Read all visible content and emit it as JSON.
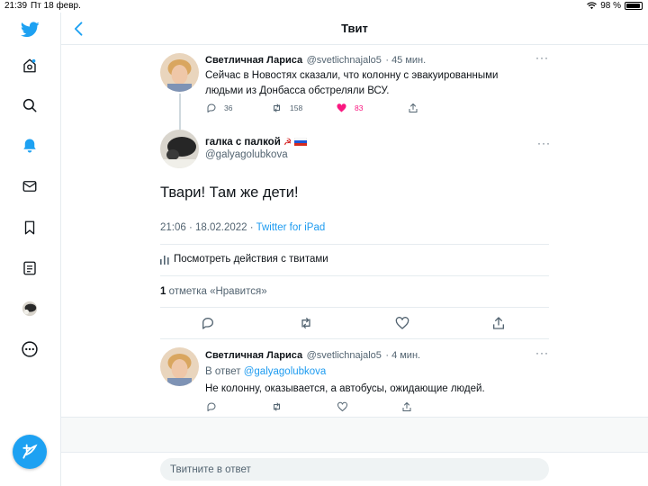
{
  "status_bar": {
    "time": "21:39",
    "date": "Пт 18 февр.",
    "battery": "98 %"
  },
  "header": {
    "title": "Твит"
  },
  "parent_tweet": {
    "name": "Светличная Лариса",
    "handle": "@svetlichnajalo5",
    "time": "· 45 мин.",
    "text": "Сейчас в Новостях сказали, что колонну с эвакуированными людьми из Донбасса обстреляли ВСУ.",
    "replies": "36",
    "retweets": "158",
    "likes": "83",
    "liked_color": "#f91880"
  },
  "main_tweet": {
    "name": "галка с палкой",
    "name_emoji": "☭",
    "handle": "@galyagolubkova",
    "text": "Твари! Там же дети!",
    "timestamp": "21:06 · 18.02.2022 · ",
    "source": "Twitter for iPad",
    "view_activity": "Посмотреть действия с твитами",
    "like_count": "1",
    "like_label": " отметка «Нравится»"
  },
  "reply_tweet": {
    "name": "Светличная Лариса",
    "handle": "@svetlichnajalo5",
    "time": "· 4 мин.",
    "reply_to_prefix": "В ответ ",
    "reply_to_handle": "@galyagolubkova",
    "text": "Не колонну, оказывается, а автобусы, ожидающие людей."
  },
  "composer": {
    "placeholder": "Твитните в ответ"
  },
  "colors": {
    "accent": "#1da1f2",
    "link": "#1d9bf0"
  },
  "icons": [
    "twitter-logo-icon",
    "home-icon",
    "search-icon",
    "notifications-icon",
    "messages-icon",
    "bookmarks-icon",
    "lists-icon",
    "profile-avatar",
    "more-icon",
    "compose-icon"
  ]
}
